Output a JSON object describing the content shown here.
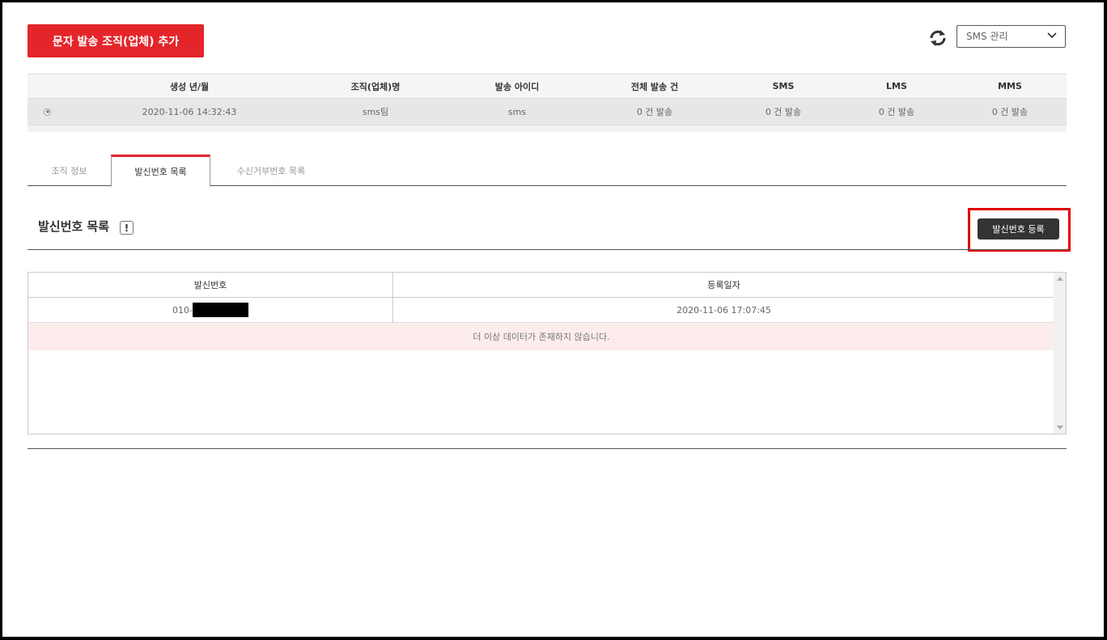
{
  "header": {
    "add_button_label": "문자 발송 조직(업체) 추가",
    "select_value": "SMS 관리"
  },
  "org_table": {
    "columns": [
      "생성 년/월",
      "조직(업체)명",
      "발송 아이디",
      "전체 발송 건",
      "SMS",
      "LMS",
      "MMS"
    ],
    "rows": [
      {
        "created": "2020-11-06 14:32:43",
        "org_name": "sms팀",
        "sender_id": "sms",
        "total_sent": "0 건 발송",
        "sms": "0 건 발송",
        "lms": "0 건 발송",
        "mms": "0 건 발송"
      }
    ]
  },
  "tabs": [
    {
      "label": "조직 정보",
      "active": false
    },
    {
      "label": "발신번호 목록",
      "active": true
    },
    {
      "label": "수신거부번호 목록",
      "active": false
    }
  ],
  "section": {
    "title": "발신번호 목록",
    "info_icon_text": "!",
    "register_button_label": "발신번호 등록"
  },
  "number_grid": {
    "columns": [
      "발신번호",
      "등록일자"
    ],
    "rows": [
      {
        "number_prefix": "010-",
        "registered": "2020-11-06 17:07:45"
      }
    ],
    "no_more_text": "더 이상 데이터가 존재하지 않습니다."
  },
  "colors": {
    "brand_red": "#e4262b",
    "dark_button": "#333333",
    "highlight": "#e00000"
  }
}
